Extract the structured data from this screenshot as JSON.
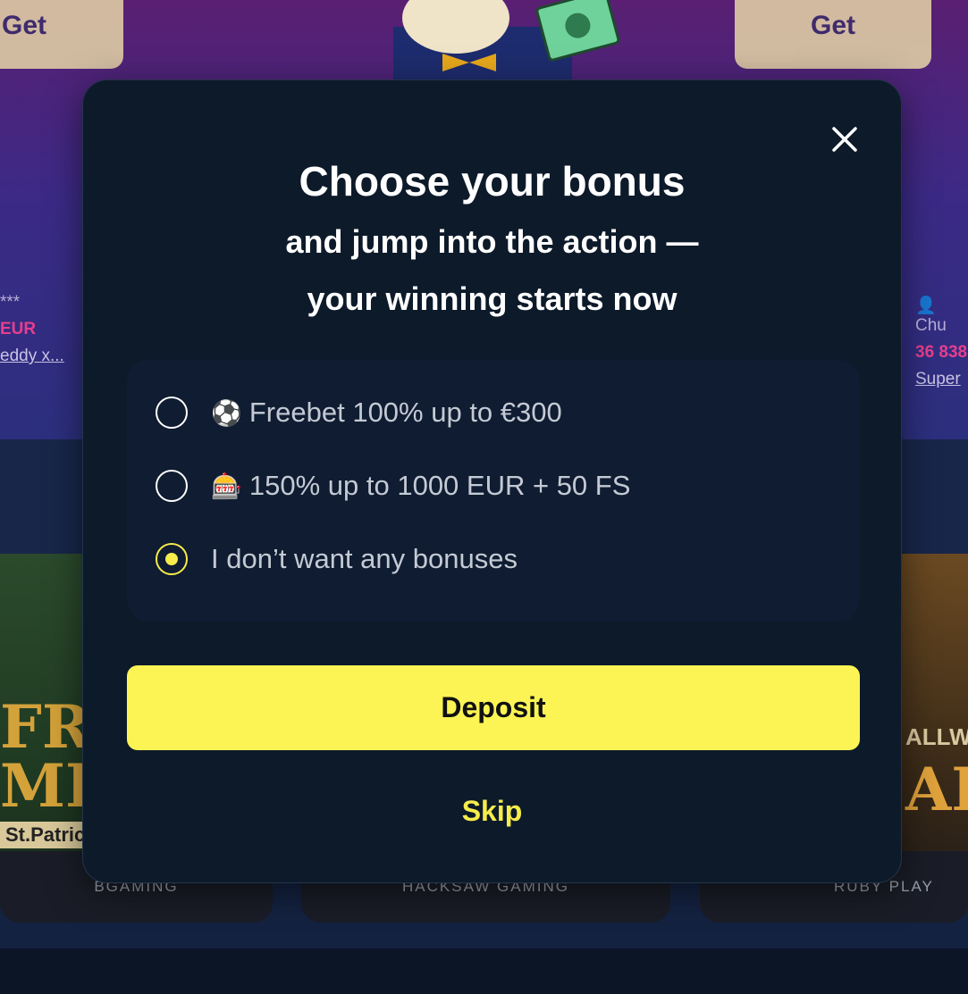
{
  "background": {
    "get_left_label": "Get",
    "get_right_label": "Get",
    "winners_left": {
      "masked_name": "***",
      "amount": "EUR",
      "game": "eddy x..."
    },
    "winners_right": {
      "name": "Chu",
      "amount": "36 838",
      "game": "Super"
    },
    "cards": {
      "left": {
        "art_text_1": "FRI",
        "art_text_2": "MILI",
        "art_subtitle": "St.Patric",
        "provider": "BGAMING"
      },
      "middle": {
        "provider": "HACKSAW GAMING"
      },
      "right": {
        "art_text": "AI",
        "art_top": "ALLWAY",
        "provider": "RUBY PLAY"
      }
    }
  },
  "modal": {
    "title": "Choose your bonus",
    "subtitle_line1": "and jump into the action —",
    "subtitle_line2": "your winning starts now",
    "options": [
      {
        "emoji": "⚽",
        "label": "Freebet 100% up to €300",
        "selected": false
      },
      {
        "emoji": "🎰",
        "label": "150% up to 1000 EUR + 50 FS",
        "selected": false
      },
      {
        "emoji": "",
        "label": "I don’t want any bonuses",
        "selected": true
      }
    ],
    "deposit_label": "Deposit",
    "skip_label": "Skip",
    "close_icon": "close-icon"
  },
  "colors": {
    "accent_yellow": "#fbf454",
    "modal_bg": "#0d1a2a",
    "winner_amount": "#e83e8c"
  }
}
